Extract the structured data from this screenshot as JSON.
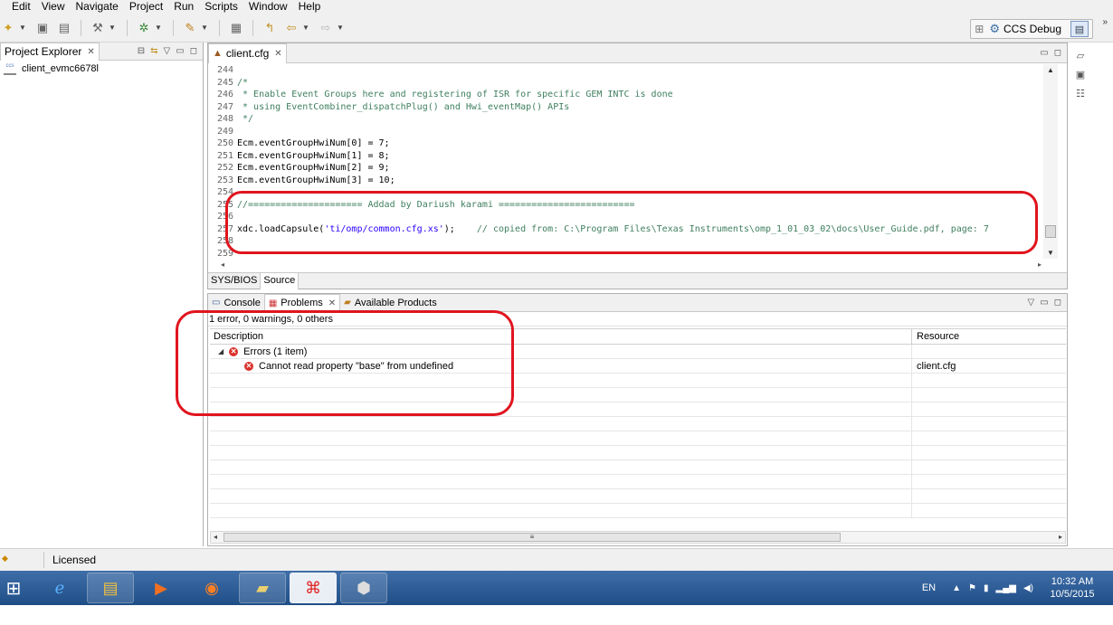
{
  "menu": [
    "Edit",
    "View",
    "Navigate",
    "Project",
    "Run",
    "Scripts",
    "Window",
    "Help"
  ],
  "toolbar": {
    "perspective_label": "CCS Debug"
  },
  "project_explorer": {
    "tab_label": "Project Explorer",
    "project_name": "client_evmc6678l"
  },
  "editor": {
    "tab_label": "client.cfg",
    "bottom_tabs": [
      "SYS/BIOS",
      "Source"
    ],
    "lines": [
      {
        "n": "244",
        "text": "",
        "kind": "plain"
      },
      {
        "n": "245",
        "text": "/*",
        "kind": "cmt"
      },
      {
        "n": "246",
        "text": " * Enable Event Groups here and registering of ISR for specific GEM INTC is done",
        "kind": "cmt"
      },
      {
        "n": "247",
        "text": " * using EventCombiner_dispatchPlug() and Hwi_eventMap() APIs",
        "kind": "cmt"
      },
      {
        "n": "248",
        "text": " */",
        "kind": "cmt"
      },
      {
        "n": "249",
        "text": "",
        "kind": "plain"
      },
      {
        "n": "250",
        "text": "Ecm.eventGroupHwiNum[0] = 7;",
        "kind": "plain"
      },
      {
        "n": "251",
        "text": "Ecm.eventGroupHwiNum[1] = 8;",
        "kind": "plain"
      },
      {
        "n": "252",
        "text": "Ecm.eventGroupHwiNum[2] = 9;",
        "kind": "plain"
      },
      {
        "n": "253",
        "text": "Ecm.eventGroupHwiNum[3] = 10;",
        "kind": "plain"
      },
      {
        "n": "254",
        "text": "",
        "kind": "plain"
      },
      {
        "n": "255",
        "text": "//===================== Addad by Dariush karami =========================",
        "kind": "cmt"
      },
      {
        "n": "256",
        "text": "",
        "kind": "plain"
      },
      {
        "n": "257",
        "text": "xdc.loadCapsule(",
        "kind": "load",
        "str": "'ti/omp/common.cfg.xs'",
        "after": ");    ",
        "comment": "// copied from: C:\\Program Files\\Texas Instruments\\omp_1_01_03_02\\docs\\User_Guide.pdf, page: 7"
      },
      {
        "n": "258",
        "text": "",
        "kind": "plain"
      },
      {
        "n": "259",
        "text": "",
        "kind": "plain"
      }
    ]
  },
  "problems": {
    "tabs": [
      "Console",
      "Problems",
      "Available Products"
    ],
    "summary": "1 error, 0 warnings, 0 others",
    "col_description": "Description",
    "col_resource": "Resource",
    "group_label": "Errors (1 item)",
    "error_description": "Cannot read property \"base\" from undefined",
    "error_resource": "client.cfg"
  },
  "statusbar": {
    "license": "Licensed"
  },
  "taskbar": {
    "lang": "EN",
    "time": "10:32 AM",
    "date": "10/5/2015"
  },
  "colors": {
    "annotation": "#e0141e",
    "comment": "#3f7f5f",
    "string": "#2a00ff",
    "error": "#d9312b"
  }
}
